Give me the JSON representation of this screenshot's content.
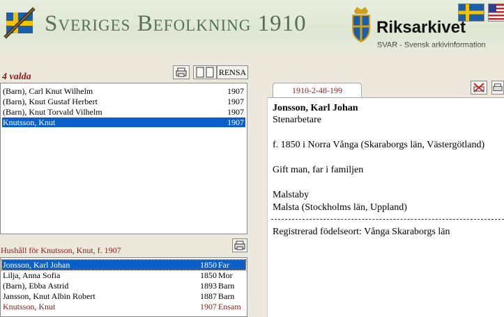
{
  "header": {
    "title": "Sveriges Befolkning 1910",
    "archive_name": "Riksarkivet",
    "archive_subtitle": "SVAR - Svensk arkivinformation"
  },
  "selection": {
    "count_label": "4 valda",
    "clear_button": "RENSA",
    "rows": [
      {
        "name": "(Barn), Carl Knut Wilhelm",
        "year": "1907",
        "selected": false
      },
      {
        "name": "(Barn), Knut Gustaf Herbert",
        "year": "1907",
        "selected": false
      },
      {
        "name": "(Barn), Knut Torvald Vilhelm",
        "year": "1907",
        "selected": false
      },
      {
        "name": "Knutsson, Knut",
        "year": "1907",
        "selected": true
      }
    ]
  },
  "household": {
    "title": "Hushåll för Knutsson, Knut, f. 1907",
    "rows": [
      {
        "name": "Jonsson, Karl Johan",
        "year": "1850",
        "role": "Far",
        "selected": true
      },
      {
        "name": "Lilja, Anna Sofia",
        "year": "1850",
        "role": "Mor",
        "selected": false
      },
      {
        "name": "(Barn), Ebba Astrid",
        "year": "1893",
        "role": "Barn",
        "selected": false
      },
      {
        "name": "Jansson, Knut Albin Robert",
        "year": "1887",
        "role": "Barn",
        "selected": false
      },
      {
        "name": "Knutsson, Knut",
        "year": "1907",
        "role": "Ensam",
        "selected": false
      }
    ]
  },
  "detail": {
    "tab_label": "1910-2-48-199",
    "name": "Jonsson, Karl Johan",
    "occupation": "Stenarbetare",
    "birth": "f. 1850 i Norra Vånga (Skaraborgs län, Västergötland)",
    "family_status": "Gift man, far i familjen",
    "residence": "Malstaby",
    "parish": "Malsta (Stockholms län, Uppland)",
    "registered_birthplace": "Registrerad födelseort: Vånga Skaraborgs län"
  },
  "colors": {
    "accent_red": "#8b1a1a",
    "selection_blue": "#0a60c8",
    "title_green": "#55705a"
  }
}
